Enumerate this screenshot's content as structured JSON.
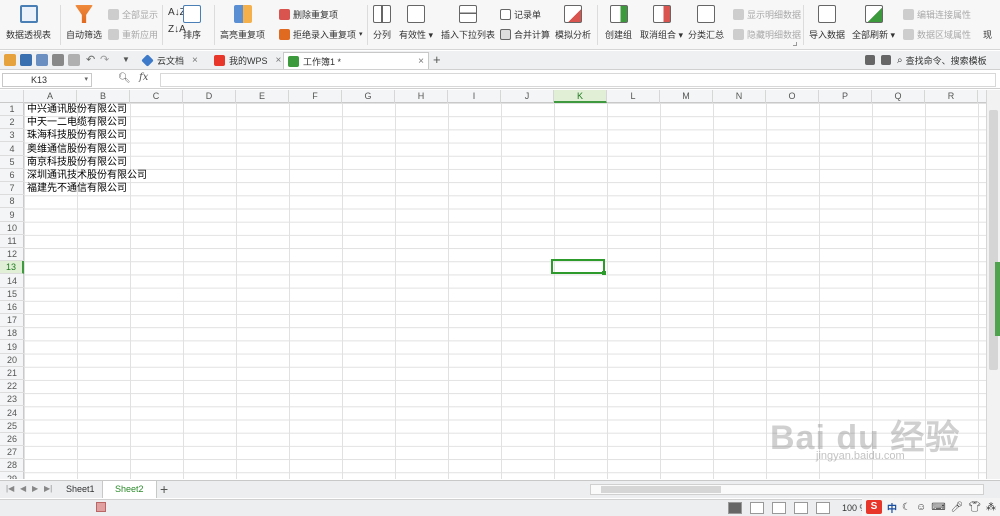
{
  "ribbon": {
    "pivot": "数据透视表",
    "auto_filter": "自动筛选",
    "show_all": "全部显示",
    "reapply": "重新应用",
    "sort": "排序",
    "highlight_dup": "高亮重复项",
    "remove_dup": "删除重复项",
    "reject_dup": "拒绝录入重复项",
    "split": "分列",
    "validity": "有效性",
    "insert_dropdown": "插入下拉列表",
    "record": "记录单",
    "merge_calc": "合并计算",
    "simulate": "模拟分析",
    "create_group": "创建组",
    "ungroup": "取消组合",
    "subtotal": "分类汇总",
    "show_detail": "显示明细数据",
    "hide_detail": "隐藏明细数据",
    "import": "导入数据",
    "refresh_all": "全部刷新",
    "edit_links": "编辑连接属性",
    "range_props": "数据区域属性",
    "existing": "现"
  },
  "tabs": {
    "cloud": "云文档",
    "mywps": "我的WPS",
    "workbook": "工作簿1 *",
    "search": "查找命令、搜索模板"
  },
  "formula": {
    "name_box": "K13",
    "fx": "fx"
  },
  "columns": [
    "A",
    "B",
    "C",
    "D",
    "E",
    "F",
    "G",
    "H",
    "I",
    "J",
    "K",
    "L",
    "M",
    "N",
    "O",
    "P",
    "Q",
    "R"
  ],
  "rows": [
    "1",
    "2",
    "3",
    "4",
    "5",
    "6",
    "7",
    "8",
    "9",
    "10",
    "11",
    "12",
    "13",
    "14",
    "15",
    "16",
    "17",
    "18",
    "19",
    "20",
    "21",
    "22",
    "23",
    "24",
    "25",
    "26",
    "27",
    "28",
    "29"
  ],
  "cells_a": [
    "中兴通讯股份有限公司",
    "中天一二电缆有限公司",
    "珠海科技股份有限公司",
    "奥维通信股份有限公司",
    "南京科技股份有限公司",
    "深圳通讯技术股份有限公司",
    "福建先不通信有限公司"
  ],
  "sheets": {
    "sheet1": "Sheet1",
    "sheet2": "Sheet2",
    "add": "+"
  },
  "status": {
    "zoom": "100 %",
    "ime_lang": "中"
  },
  "watermark": {
    "main": "Bai du 经验",
    "sub": "jingyan.baidu.com"
  },
  "colors": {
    "accent_green": "#2c9b2c",
    "selected_header": "#e1efd6"
  }
}
